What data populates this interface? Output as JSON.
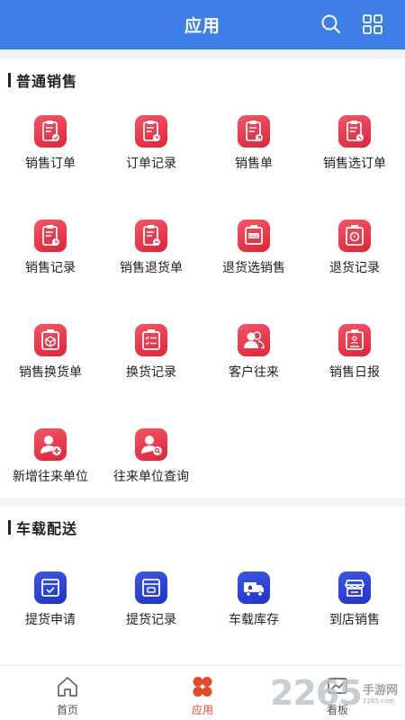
{
  "header": {
    "title": "应用"
  },
  "sections": [
    {
      "title": "普通销售",
      "items": [
        {
          "label": "销售订单",
          "icon": "sales-order-icon"
        },
        {
          "label": "订单记录",
          "icon": "order-record-icon"
        },
        {
          "label": "销售单",
          "icon": "sales-slip-icon"
        },
        {
          "label": "销售选订单",
          "icon": "sales-select-order-icon"
        },
        {
          "label": "销售记录",
          "icon": "sales-record-icon"
        },
        {
          "label": "销售退货单",
          "icon": "sales-return-icon"
        },
        {
          "label": "退货选销售",
          "icon": "return-select-sale-icon"
        },
        {
          "label": "退货记录",
          "icon": "return-record-icon"
        },
        {
          "label": "销售换货单",
          "icon": "sales-exchange-icon"
        },
        {
          "label": "换货记录",
          "icon": "exchange-record-icon"
        },
        {
          "label": "客户往来",
          "icon": "customer-contacts-icon"
        },
        {
          "label": "销售日报",
          "icon": "sales-daily-report-icon"
        },
        {
          "label": "新增往来单位",
          "icon": "add-partner-icon"
        },
        {
          "label": "往来单位查询",
          "icon": "partner-search-icon"
        }
      ]
    },
    {
      "title": "车载配送",
      "items": [
        {
          "label": "提货申请",
          "icon": "pickup-request-icon"
        },
        {
          "label": "提货记录",
          "icon": "pickup-record-icon"
        },
        {
          "label": "车载库存",
          "icon": "vehicle-inventory-icon"
        },
        {
          "label": "到店销售",
          "icon": "in-store-sale-icon"
        }
      ]
    }
  ],
  "tabs": [
    {
      "label": "首页",
      "icon": "home-icon"
    },
    {
      "label": "应用",
      "icon": "apps-icon"
    },
    {
      "label": "看板",
      "icon": "dashboard-icon"
    }
  ],
  "watermark": {
    "number": "2265",
    "text": "手游网",
    "url": "2265.com"
  },
  "colors": {
    "header": "#3d7ee8",
    "red_icon": "#e83446",
    "blue_icon": "#2a3fd6",
    "active_tab": "#e24a2a"
  }
}
